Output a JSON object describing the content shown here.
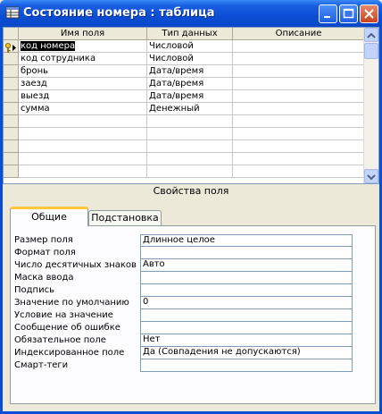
{
  "window": {
    "title": "Состояние номера : таблица"
  },
  "grid": {
    "columns": [
      "Имя поля",
      "Тип данных",
      "Описание"
    ],
    "rows": [
      {
        "name": "код номера",
        "type": "Числовой",
        "desc": ""
      },
      {
        "name": "код сотрудника",
        "type": "Числовой",
        "desc": ""
      },
      {
        "name": "бронь",
        "type": "Дата/время",
        "desc": ""
      },
      {
        "name": "заезд",
        "type": "Дата/время",
        "desc": ""
      },
      {
        "name": "выезд",
        "type": "Дата/время",
        "desc": ""
      },
      {
        "name": "сумма",
        "type": "Денежный",
        "desc": ""
      },
      {
        "name": "",
        "type": "",
        "desc": ""
      },
      {
        "name": "",
        "type": "",
        "desc": ""
      },
      {
        "name": "",
        "type": "",
        "desc": ""
      },
      {
        "name": "",
        "type": "",
        "desc": ""
      },
      {
        "name": "",
        "type": "",
        "desc": ""
      }
    ]
  },
  "properties": {
    "caption": "Свойства поля",
    "tabs": [
      "Общие",
      "Подстановка"
    ],
    "items": [
      {
        "label": "Размер поля",
        "value": "Длинное целое"
      },
      {
        "label": "Формат поля",
        "value": ""
      },
      {
        "label": "Число десятичных знаков",
        "value": "Авто"
      },
      {
        "label": "Маска ввода",
        "value": ""
      },
      {
        "label": "Подпись",
        "value": ""
      },
      {
        "label": "Значение по умолчанию",
        "value": "0"
      },
      {
        "label": "Условие на значение",
        "value": ""
      },
      {
        "label": "Сообщение об ошибке",
        "value": ""
      },
      {
        "label": "Обязательное поле",
        "value": "Нет"
      },
      {
        "label": "Индексированное поле",
        "value": "Да (Совпадения не допускаются)"
      },
      {
        "label": "Смарт-теги",
        "value": ""
      }
    ]
  },
  "colors": {
    "titlebar": "#0a4ed6",
    "selection": "#000000",
    "tab_accent": "#ffc83c"
  }
}
